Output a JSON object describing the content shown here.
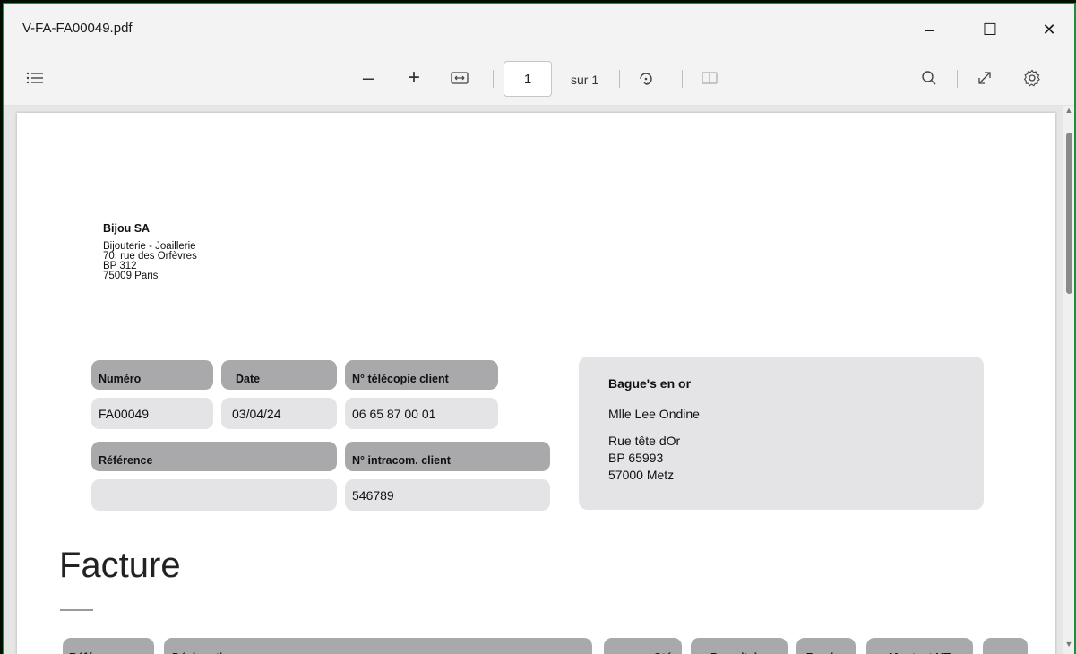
{
  "window": {
    "title": "V-FA-FA00049.pdf",
    "minimize_glyph": "–",
    "maximize_glyph": "☐",
    "close_glyph": "✕"
  },
  "toolbar": {
    "toc_icon": "list-icon",
    "zoom_out_glyph": "–",
    "zoom_in_glyph": "+",
    "fit_icon": "fit-width-icon",
    "page_value": "1",
    "page_total": "sur 1",
    "rotate_icon": "rotate-icon",
    "two_page_icon": "two-page-icon",
    "search_icon": "search-icon",
    "fullscreen_icon": "expand-icon",
    "settings_icon": "gear-icon"
  },
  "document": {
    "company": {
      "name": "Bijou SA",
      "lines": [
        "Bijouterie - Joaillerie",
        "70, rue des Orfèvres",
        "BP 312",
        "75009 Paris"
      ]
    },
    "fields": {
      "numero_label": "Numéro",
      "numero_value": "FA00049",
      "date_label": "Date",
      "date_value": "03/04/24",
      "fax_label": "N° télécopie client",
      "fax_value": "06 65 87 00 01",
      "reference_label": "Référence",
      "reference_value": "",
      "intracom_label": "N° intracom. client",
      "intracom_value": "546789"
    },
    "client": {
      "name": "Bague's en or",
      "contact": "Mlle Lee Ondine",
      "address_lines": [
        "Rue tête dOr",
        "BP 65993",
        "57000 Metz"
      ]
    },
    "title": "Facture",
    "table_headers": [
      "Référence",
      "Désignation",
      "Qté",
      "Px unitaire",
      "Remise",
      "Montant HT",
      "+"
    ]
  },
  "colors": {
    "label_bg": "#a9a9ab",
    "value_bg": "#e4e3e6",
    "window_border": "#1e8f3a"
  }
}
